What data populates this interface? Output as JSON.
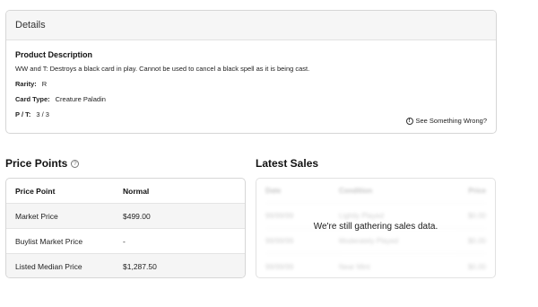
{
  "details": {
    "header": "Details",
    "product_description_title": "Product Description",
    "product_description_text": "WW and T: Destroys a black card in play. Cannot be used to cancel a black spell as it is being cast.",
    "rarity_label": "Rarity:",
    "rarity_value": "R",
    "card_type_label": "Card Type:",
    "card_type_value": "Creature Paladin",
    "pt_label": "P / T:",
    "pt_value": "3 / 3",
    "wrong_link": "See Something Wrong?"
  },
  "price_points": {
    "title": "Price Points",
    "col_headers": [
      "Price Point",
      "Normal"
    ],
    "rows": [
      {
        "label": "Market Price",
        "value": "$499.00"
      },
      {
        "label": "Buylist Market Price",
        "value": "-"
      },
      {
        "label": "Listed Median Price",
        "value": "$1,287.50"
      }
    ]
  },
  "latest_sales": {
    "title": "Latest Sales",
    "col_headers": [
      "Date",
      "Condition",
      "Price"
    ],
    "placeholder_rows": [
      {
        "date": "99/99/99",
        "condition": "Lightly Played",
        "price": "$0.00"
      },
      {
        "date": "99/99/99",
        "condition": "Moderately Played",
        "price": "$0.00"
      },
      {
        "date": "99/99/99",
        "condition": "Near Mint",
        "price": "$0.00"
      }
    ],
    "message": "We're still gathering sales data."
  }
}
